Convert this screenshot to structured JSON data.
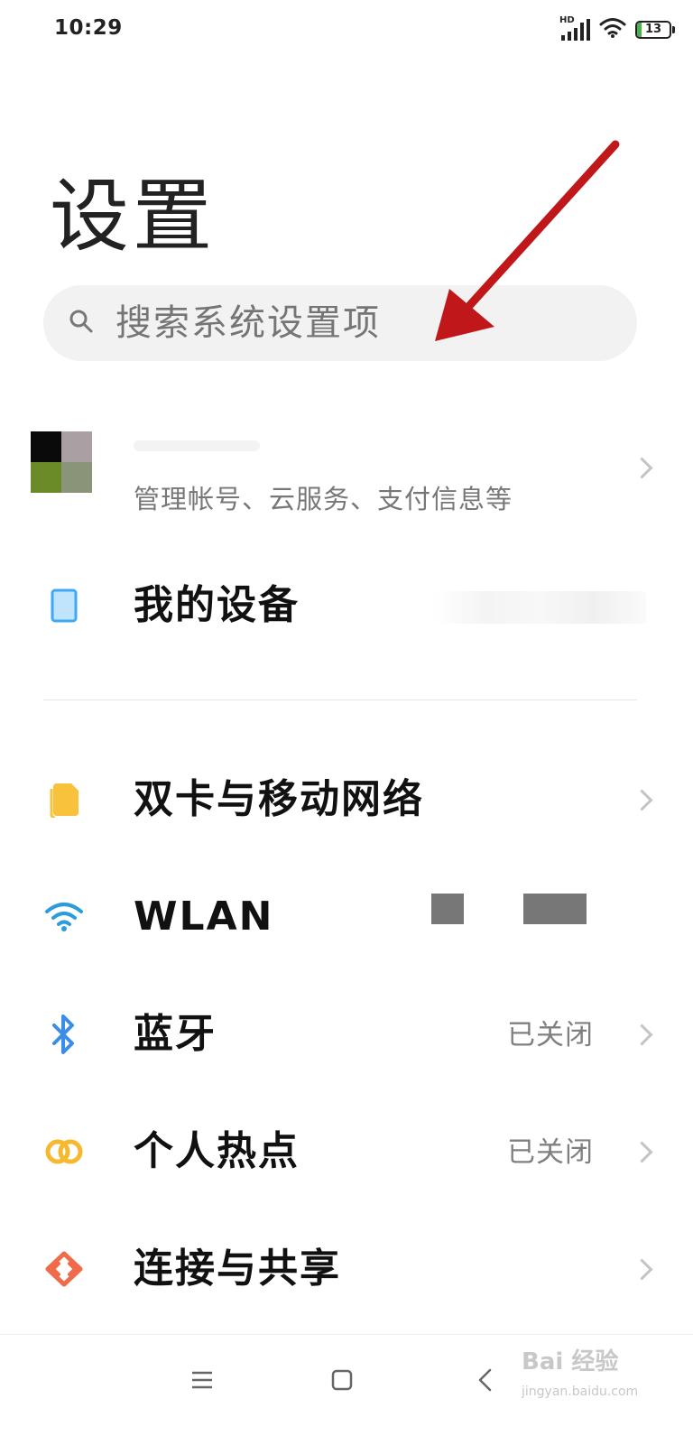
{
  "status_bar": {
    "time": "10:29",
    "network_label": "HD",
    "battery_level": "13",
    "battery_fraction": 0.13
  },
  "page": {
    "title": "设置"
  },
  "search": {
    "placeholder": "搜索系统设置项",
    "icon": "search-icon"
  },
  "account": {
    "subtitle": "管理帐号、云服务、支付信息等",
    "avatar_colors": [
      "#0a0a0a",
      "#aaa0a4",
      "#6b8a28",
      "#8a9478"
    ]
  },
  "items": [
    {
      "label": "我的设备",
      "icon": "phone-icon",
      "value": "",
      "icon_color": "#3fa9f5"
    },
    {
      "label": "双卡与移动网络",
      "icon": "sim-card-icon",
      "value": "",
      "icon_color": "#f9c23c"
    },
    {
      "label": "WLAN",
      "icon": "wifi-icon",
      "value": "",
      "icon_color": "#2d9cdb"
    },
    {
      "label": "蓝牙",
      "icon": "bluetooth-icon",
      "value": "已关闭",
      "icon_color": "#3b8ee8"
    },
    {
      "label": "个人热点",
      "icon": "hotspot-icon",
      "value": "已关闭",
      "icon_color": "#f5b82e"
    },
    {
      "label": "连接与共享",
      "icon": "share-icon",
      "value": "",
      "icon_color": "#ef6b4a"
    }
  ],
  "nav": {
    "menu_icon": "menu-icon",
    "home_icon": "home-icon",
    "back_icon": "back-icon"
  },
  "watermark": {
    "text": "Bai 经验",
    "sub": "jingyan.baidu.com"
  },
  "colors": {
    "annotation_arrow": "#c0181a"
  }
}
